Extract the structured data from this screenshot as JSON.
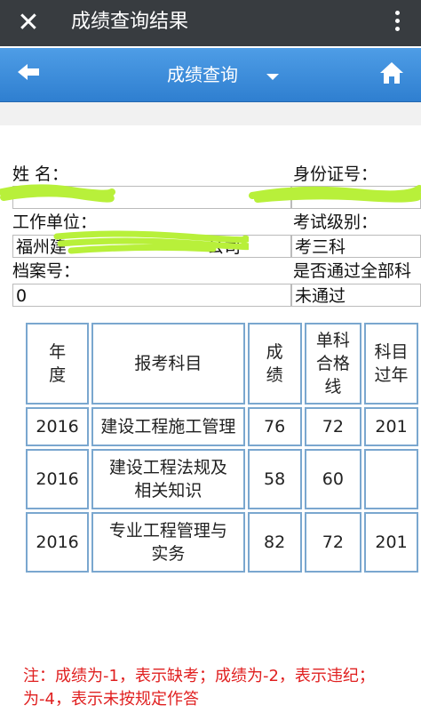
{
  "appbar": {
    "title": "成绩查询结果",
    "close_icon": "close-icon",
    "more_icon": "more-vertical-icon"
  },
  "navbar": {
    "title": "成绩查询",
    "back_icon": "back-arrow-icon",
    "home_icon": "home-icon",
    "colors": {
      "bar": "#3a8ad9"
    }
  },
  "info": {
    "name_label": "姓    名：",
    "id_label": "身份证号：",
    "employer_label": "工作单位：",
    "employer_value": "福州建",
    "employer_suffix": "公司",
    "exam_level_label": "考试级别：",
    "exam_level_value": "考三科",
    "file_no_label": "档案号：",
    "file_no_value": "0",
    "passed_all_label": "是否通过全部科",
    "passed_all_value": "未通过"
  },
  "table": {
    "headers": [
      "年\n度",
      "报考科目",
      "成\n绩",
      "单科\n合格\n线",
      "科目\n过年"
    ],
    "rows": [
      {
        "year": "2016",
        "subject": "建设工程施工管理",
        "score": "76",
        "pass_line": "72",
        "extra": "201"
      },
      {
        "year": "2016",
        "subject": "建设工程法规及相关知识",
        "score": "58",
        "pass_line": "60",
        "extra": ""
      },
      {
        "year": "2016",
        "subject": "专业工程管理与实务",
        "score": "82",
        "pass_line": "72",
        "extra": "201"
      }
    ]
  },
  "note": {
    "line1": "注：成绩为-1，表示缺考；成绩为-2，表示违纪；",
    "line2": "为-4，表示未按规定作答"
  }
}
